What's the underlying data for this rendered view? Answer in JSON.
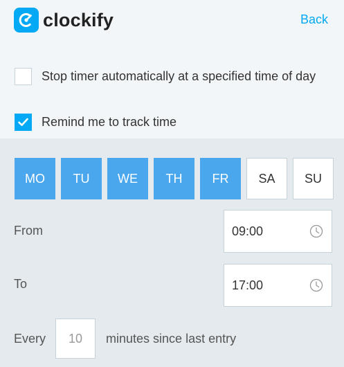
{
  "header": {
    "app_name": "clockify",
    "back_label": "Back"
  },
  "options": {
    "stop_timer": {
      "label": "Stop timer automatically at a specified time of day",
      "checked": false
    },
    "remind": {
      "label": "Remind me to track time",
      "checked": true
    }
  },
  "days": [
    {
      "label": "MO",
      "active": true
    },
    {
      "label": "TU",
      "active": true
    },
    {
      "label": "WE",
      "active": true
    },
    {
      "label": "TH",
      "active": true
    },
    {
      "label": "FR",
      "active": true
    },
    {
      "label": "SA",
      "active": false
    },
    {
      "label": "SU",
      "active": false
    }
  ],
  "from": {
    "label": "From",
    "value": "09:00",
    "icon": "clock-icon"
  },
  "to": {
    "label": "To",
    "value": "17:00",
    "icon": "clock-icon"
  },
  "every": {
    "label": "Every",
    "value": "10",
    "suffix": "minutes since last entry"
  },
  "colors": {
    "accent": "#03a9f4",
    "day_active": "#4aa7ee",
    "background": "#e4eaee",
    "panel": "#f2f6f8"
  }
}
